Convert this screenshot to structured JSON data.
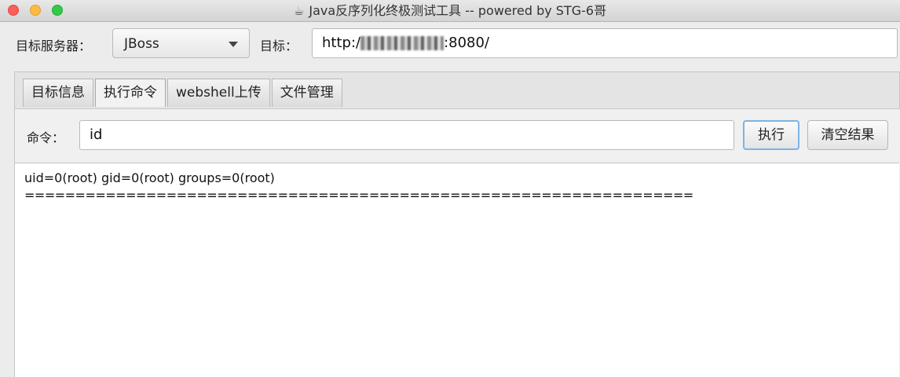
{
  "window": {
    "title": "Java反序列化终极测试工具  -- powered by STG-6哥",
    "title_icon": "coffee-cup-icon"
  },
  "top": {
    "server_label": "目标服务器：",
    "server_selected": "JBoss",
    "target_label": "目标：",
    "target_url_prefix": "http:/",
    "target_url_suffix": ":8080/"
  },
  "tabs": [
    {
      "label": "目标信息"
    },
    {
      "label": "执行命令"
    },
    {
      "label": "webshell上传"
    },
    {
      "label": "文件管理"
    }
  ],
  "command": {
    "label": "命令：",
    "value": "id",
    "execute_label": "执行",
    "clear_label": "清空结果"
  },
  "output": {
    "line1": "uid=0(root) gid=0(root) groups=0(root)",
    "line2": "=================================================================="
  },
  "colors": {
    "close": "#fc605c",
    "minimize": "#fdbc40",
    "maximize": "#34c84a",
    "focus_ring": "#7db3e6"
  }
}
